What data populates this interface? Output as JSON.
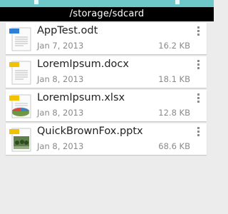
{
  "status_bar": {},
  "path_bar": {
    "path": "/storage/sdcard"
  },
  "colors": {
    "accent": "#6ec8c9",
    "path_bar_bg": "#000000",
    "card_bg": "#ffffff",
    "secondary_text": "#8a8a8a"
  },
  "files": [
    {
      "name": "AppTest.odt",
      "date": "Jan 7, 2013",
      "size": "16.2 KB",
      "icon": "odt-document-icon"
    },
    {
      "name": "LoremIpsum.docx",
      "date": "Jan 8, 2013",
      "size": "18.1 KB",
      "icon": "docx-document-icon"
    },
    {
      "name": "LoremIpsum.xlsx",
      "date": "Jan 8, 2013",
      "size": "12.8 KB",
      "icon": "xlsx-spreadsheet-icon"
    },
    {
      "name": "QuickBrownFox.pptx",
      "date": "Jan 8, 2013",
      "size": "68.6 KB",
      "icon": "pptx-presentation-icon"
    }
  ]
}
